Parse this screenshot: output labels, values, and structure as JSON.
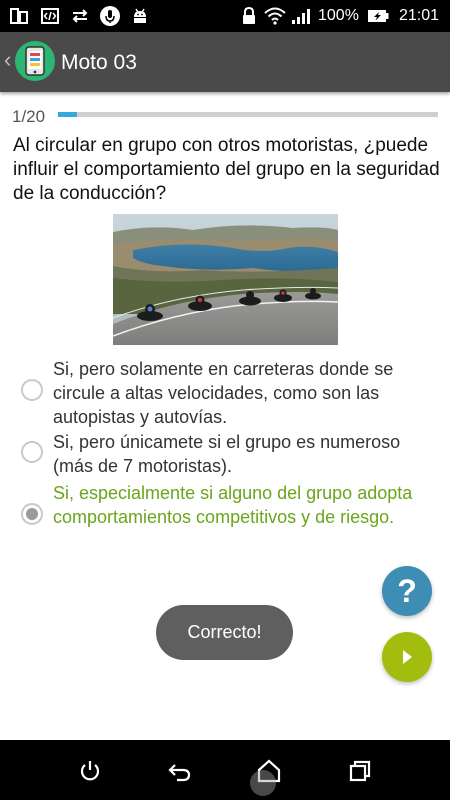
{
  "status_bar": {
    "battery_percent": "100%",
    "time": "21:01",
    "icons": [
      "screen-mirror-icon",
      "code-icon",
      "usb-transfer-icon",
      "microphone-icon",
      "android-icon",
      "lock-icon",
      "wifi-icon",
      "signal-icon",
      "battery-icon"
    ]
  },
  "app_bar": {
    "title": "Moto 03",
    "back_icon": "chevron-left-icon",
    "logo_icon": "phone-app-icon"
  },
  "quiz": {
    "progress_label": "1/20",
    "progress_fraction": 0.05,
    "question": "Al circular en grupo con otros motoristas, ¿puede influir el comportamiento del grupo en la seguridad de la conducción?",
    "image_subject": "group of motorcyclists riding on a curved road by a lake",
    "options": [
      {
        "text": "Si, pero solamente en carreteras donde se circule a altas velocidades, como son las autopistas y autovías.",
        "selected": false,
        "correct": false
      },
      {
        "text": "Si, pero únicamete si el grupo es numeroso (más de 7 motoristas).",
        "selected": false,
        "correct": false
      },
      {
        "text": "Si, especialmente si alguno del grupo adopta comportamientos competitivos y de riesgo.",
        "selected": true,
        "correct": true
      }
    ],
    "help_label": "?",
    "toast": "Correcto!"
  },
  "nav_bar": {
    "icons": [
      "power-icon",
      "back-icon",
      "home-icon",
      "recents-icon"
    ]
  },
  "colors": {
    "app_bar": "#4a4a4a",
    "progress": "#33aadd",
    "correct_text": "#6aa51c",
    "help_button": "#3d8db5",
    "next_button": "#a2bd0e",
    "toast": "#5f5f5f"
  }
}
